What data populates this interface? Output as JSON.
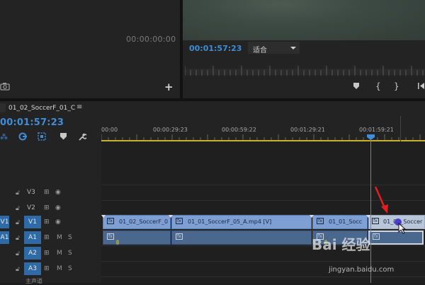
{
  "source_monitor": {
    "timecode": "00:00:00:00"
  },
  "program_monitor": {
    "timecode": "00:01:57:23",
    "fit_label": "适合"
  },
  "sequence": {
    "tab_name": "01_02_SoccerF_01_C",
    "menu_glyph": "≡",
    "timecode": "00:01:57:23"
  },
  "ruler": {
    "ticks": [
      "00:00",
      "00:00:29:23",
      "00:00:59:22",
      "00:01:29:21",
      "00:01:59:21"
    ]
  },
  "tracks": [
    {
      "target": "",
      "name": "V3",
      "icons": [
        "lock-icon",
        "film-icon",
        "eye-icon"
      ]
    },
    {
      "target": "",
      "name": "V2",
      "icons": [
        "lock-icon",
        "film-icon",
        "eye-icon"
      ]
    },
    {
      "target": "V1",
      "name": "V1",
      "icons": [
        "lock-icon",
        "film-icon",
        "eye-icon"
      ]
    },
    {
      "target": "A1",
      "name": "A1",
      "m": "M",
      "s": "S"
    },
    {
      "target": "",
      "name": "A2",
      "m": "M",
      "s": "S"
    },
    {
      "target": "",
      "name": "A3",
      "m": "M",
      "s": "S"
    }
  ],
  "video_clips": [
    {
      "label": "01_02_SoccerF_0",
      "selected": false
    },
    {
      "label": "01_01_SoccerF_05_A.mp4 [V]",
      "selected": false
    },
    {
      "label": "01_01_Socc",
      "selected": false
    },
    {
      "label": "01_02_Soccer",
      "selected": true
    }
  ],
  "bottom_track_label": "主声道",
  "watermark": {
    "text": "Bai 经验",
    "sub": "jingyan.baidu.com"
  },
  "colors": {
    "accent": "#3f8dd6",
    "video_clip": "#7d9fd4",
    "audio_clip": "#4a678e",
    "ruler_line": "#c9b22a",
    "annotation": "#e02020"
  }
}
